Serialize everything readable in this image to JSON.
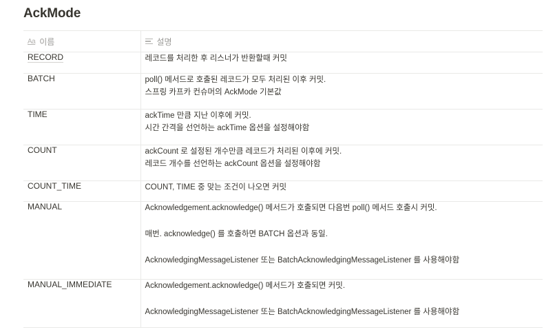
{
  "page": {
    "title": "AckMode"
  },
  "table": {
    "headers": {
      "name": "이름",
      "description": "설명"
    },
    "rows": [
      {
        "name": "RECORD",
        "lines": [
          "레코드를 처리한 후 리스너가 반환할때  커밋"
        ]
      },
      {
        "name": "BATCH",
        "lines": [
          "poll() 메서드로 호출된 레코드가 모두 처리된 이후 커밋.",
          "스프링 카프카 컨슈머의 AckMode 기본값"
        ]
      },
      {
        "name": "TIME",
        "lines": [
          "ackTime 만큼 지난 이후에 커밋.",
          "시간 간격을 선언하는 ackTime 옵션을 설정해야함"
        ]
      },
      {
        "name": "COUNT",
        "lines": [
          "ackCount 로 설정된 개수만큼 레코드가 처리된 이후에 커밋.",
          "레코드 개수를 선언하는 ackCount 옵션을 설정해야함"
        ]
      },
      {
        "name": "COUNT_TIME",
        "lines": [
          "COUNT, TIME 중 맞는 조건이 나오면 커밋"
        ]
      },
      {
        "name": "MANUAL",
        "lines": [
          "Acknowledgement.acknowledge() 메서드가 호출되면 다음번 poll() 메서드 호출시 커밋.",
          "매번. acknowledge() 를 호출하면 BATCH 옵션과 동일.",
          "AcknowledgingMessageListener 또는 BatchAcknowledgingMessageListener 를 사용해야함"
        ]
      },
      {
        "name": "MANUAL_IMMEDIATE",
        "lines": [
          "Acknowledgement.acknowledge() 메서드가 호출되면 커밋.",
          "AcknowledgingMessageListener 또는 BatchAcknowledgingMessageListener 를 사용해야함"
        ]
      }
    ]
  },
  "icons": {
    "name_column": "text-property-icon",
    "description_column": "long-text-property-icon"
  }
}
